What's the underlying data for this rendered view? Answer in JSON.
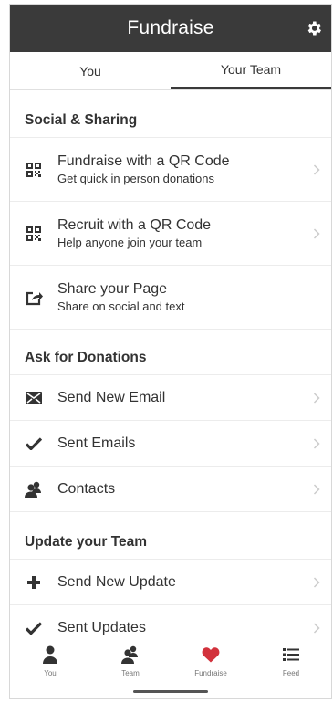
{
  "header": {
    "title": "Fundraise",
    "settings_icon": "gear-icon"
  },
  "tabs": [
    {
      "label": "You",
      "active": false
    },
    {
      "label": "Your Team",
      "active": true
    }
  ],
  "sections": {
    "social": {
      "title": "Social & Sharing",
      "items": [
        {
          "title": "Fundraise with a QR Code",
          "subtitle": "Get quick in person donations",
          "icon": "qr-code-icon"
        },
        {
          "title": "Recruit with a QR Code",
          "subtitle": "Help anyone join your team",
          "icon": "qr-code-icon"
        },
        {
          "title": "Share your Page",
          "subtitle": "Share on social and text",
          "icon": "share-icon"
        }
      ]
    },
    "donations": {
      "title": "Ask for Donations",
      "items": [
        {
          "title": "Send New Email",
          "icon": "envelope-icon"
        },
        {
          "title": "Sent Emails",
          "icon": "checkmark-icon"
        },
        {
          "title": "Contacts",
          "icon": "contacts-icon"
        }
      ]
    },
    "team": {
      "title": "Update your Team",
      "items": [
        {
          "title": "Send New Update",
          "icon": "plus-icon"
        },
        {
          "title": "Sent Updates",
          "icon": "checkmark-icon"
        }
      ]
    }
  },
  "bottom_nav": [
    {
      "label": "You",
      "icon": "person-icon"
    },
    {
      "label": "Team",
      "icon": "team-icon"
    },
    {
      "label": "Fundraise",
      "icon": "heart-icon",
      "active": true
    },
    {
      "label": "Feed",
      "icon": "list-icon"
    }
  ],
  "colors": {
    "header_bg": "#3a3a3a",
    "accent_red": "#d2323c",
    "text": "#333333"
  }
}
